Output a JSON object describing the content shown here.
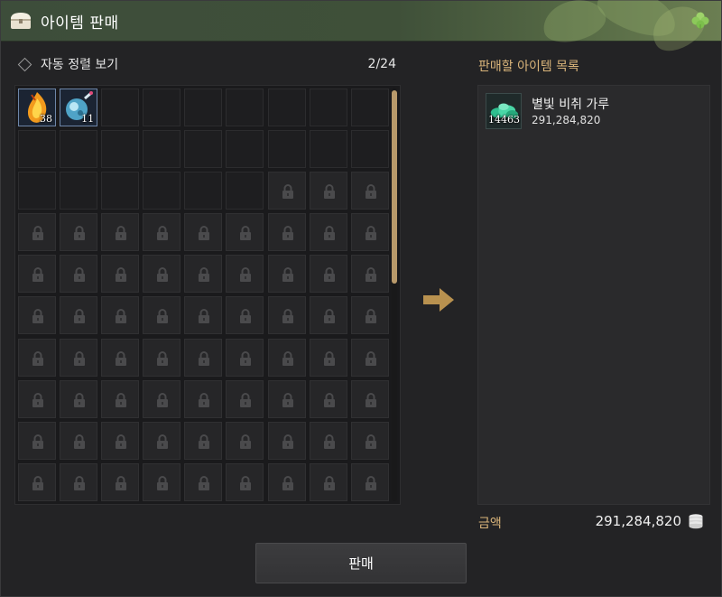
{
  "window": {
    "title": "아이템 판매",
    "accent_color": "#d9b47a",
    "icons": {
      "title": "chest-icon",
      "corner": "clover-icon"
    }
  },
  "inventory": {
    "sort_label": "자동 정렬 보기",
    "slot_count": "2/24",
    "columns": 9,
    "rows": 10,
    "items": [
      {
        "name": "fire-crystal-icon",
        "quantity": "38"
      },
      {
        "name": "ice-orb-icon",
        "quantity": "11"
      }
    ],
    "empty_slots": 22,
    "locked_slots": 66
  },
  "sell_list": {
    "title": "판매할 아이템 목록",
    "items": [
      {
        "name": "별빛 비취 가루",
        "quantity": "14463",
        "price": "291,284,820",
        "icon": "jade-powder-icon"
      }
    ]
  },
  "total": {
    "label": "금액",
    "value": "291,284,820",
    "icon": "gold-coins-icon"
  },
  "actions": {
    "sell_label": "판매"
  }
}
